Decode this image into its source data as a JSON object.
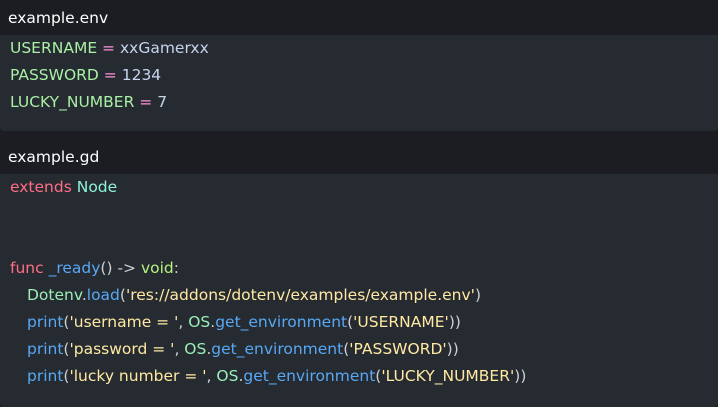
{
  "env_panel": {
    "filename": "example.env",
    "lines": [
      {
        "key": "USERNAME",
        "eq": " = ",
        "value": "xxGamerxx"
      },
      {
        "key": "PASSWORD",
        "eq": " = ",
        "value": "1234"
      },
      {
        "key": "LUCKY_NUMBER",
        "eq": " = ",
        "value": "7"
      }
    ]
  },
  "gd_panel": {
    "filename": "example.gd",
    "line1": {
      "keyword": "extends",
      "class": "Node"
    },
    "func_line": {
      "keyword": "func",
      "name": "_ready",
      "parens": "()",
      "arrow": " -> ",
      "ret": "void",
      "colon": ":"
    },
    "load_line": {
      "obj": "Dotenv",
      "dot": ".",
      "method": "load",
      "open": "(",
      "arg": "'res://addons/dotenv/examples/example.env'",
      "close": ")"
    },
    "print_lines": [
      {
        "fn": "print",
        "open": "(",
        "label": "'username = '",
        "comma": ", ",
        "obj": "OS",
        "dot": ".",
        "method": "get_environment",
        "open2": "(",
        "arg": "'USERNAME'",
        "close": "))"
      },
      {
        "fn": "print",
        "open": "(",
        "label": "'password = '",
        "comma": ", ",
        "obj": "OS",
        "dot": ".",
        "method": "get_environment",
        "open2": "(",
        "arg": "'PASSWORD'",
        "close": "))"
      },
      {
        "fn": "print",
        "open": "(",
        "label": "'lucky number = '",
        "comma": ", ",
        "obj": "OS",
        "dot": ".",
        "method": "get_environment",
        "open2": "(",
        "arg": "'LUCKY_NUMBER'",
        "close": "))"
      }
    ]
  }
}
